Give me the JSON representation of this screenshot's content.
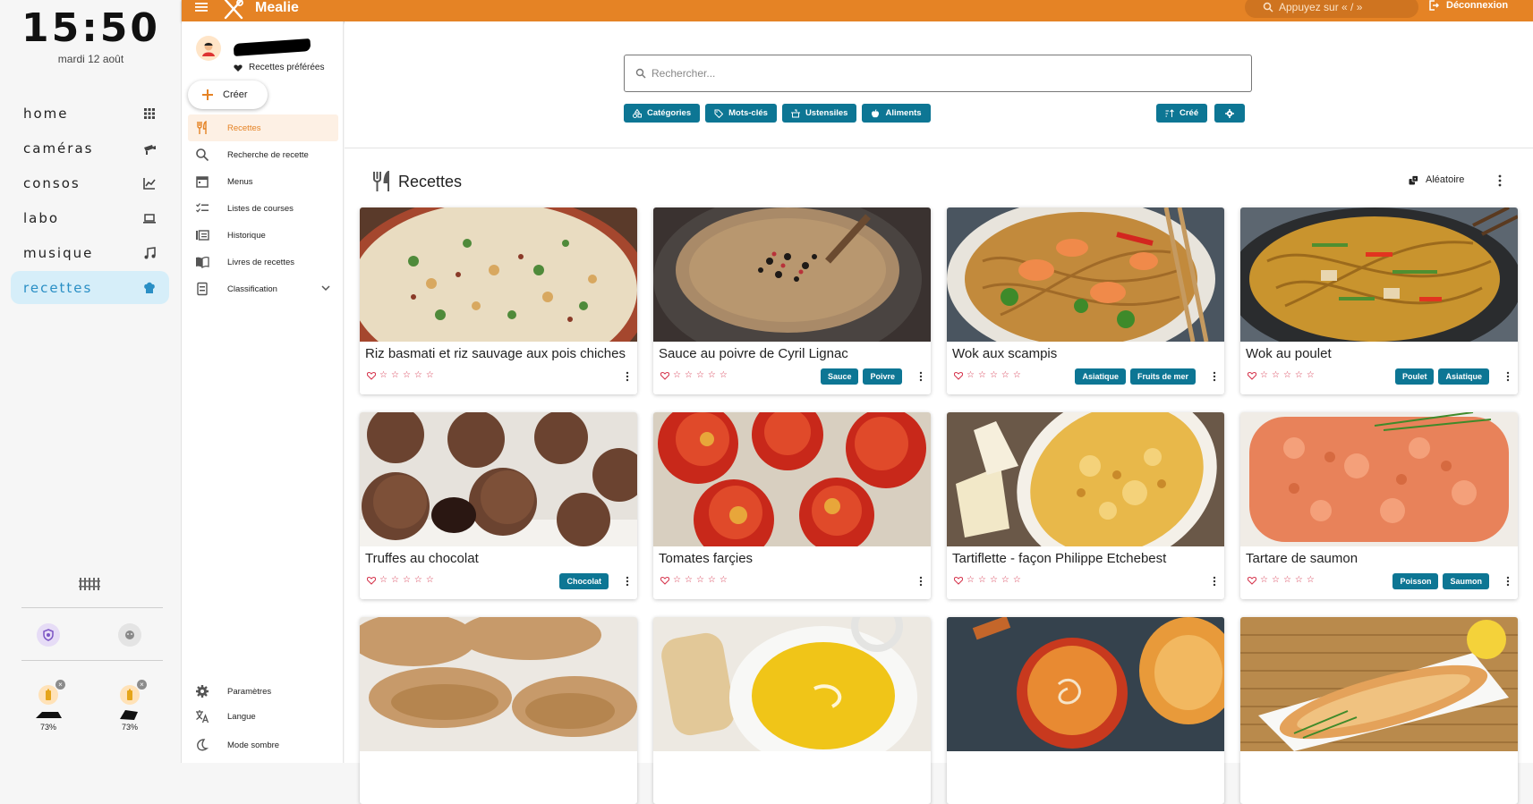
{
  "dashboard": {
    "time": "15:50",
    "date": "mardi 12 août",
    "nav": [
      {
        "label": "home",
        "icon": "grid-icon"
      },
      {
        "label": "caméras",
        "icon": "camera-icon"
      },
      {
        "label": "consos",
        "icon": "chart-icon"
      },
      {
        "label": "labo",
        "icon": "laptop-icon"
      },
      {
        "label": "musique",
        "icon": "music-icon"
      },
      {
        "label": "recettes",
        "icon": "chef-hat-icon",
        "active": true
      }
    ],
    "batteries": [
      {
        "percent": "73%",
        "device": "robot-mower-icon"
      },
      {
        "percent": "73%",
        "device": "robot-mower-icon"
      }
    ]
  },
  "topbar": {
    "title": "Mealie",
    "search_placeholder": "Appuyez sur « / »",
    "logout": "Déconnexion",
    "color": "#e58325"
  },
  "sidebar": {
    "favorites": "Recettes préférées",
    "create": "Créer",
    "items": [
      {
        "label": "Recettes",
        "icon": "utensils-icon",
        "active": true
      },
      {
        "label": "Recherche de recette",
        "icon": "search-icon"
      },
      {
        "label": "Menus",
        "icon": "calendar-icon"
      },
      {
        "label": "Listes de courses",
        "icon": "checklist-icon"
      },
      {
        "label": "Historique",
        "icon": "history-icon"
      },
      {
        "label": "Livres de recettes",
        "icon": "book-icon"
      },
      {
        "label": "Classification",
        "icon": "tag-icon"
      }
    ],
    "bottom": [
      {
        "label": "Paramètres",
        "icon": "gear-icon"
      },
      {
        "label": "Langue",
        "icon": "translate-icon"
      },
      {
        "label": "Mode sombre",
        "icon": "moon-icon"
      }
    ]
  },
  "main": {
    "search_placeholder": "Rechercher...",
    "filters": [
      "Catégories",
      "Mots-clés",
      "Ustensiles",
      "Aliments"
    ],
    "sort_label": "Créé",
    "section_title": "Recettes",
    "random": "Aléatoire",
    "accent": "#0d7694"
  },
  "recipes": [
    {
      "title": "Riz basmati et riz sauvage aux pois chiches",
      "tags": []
    },
    {
      "title": "Sauce au poivre de Cyril Lignac",
      "tags": [
        "Sauce",
        "Poivre"
      ]
    },
    {
      "title": "Wok aux scampis",
      "tags": [
        "Asiatique",
        "Fruits de mer"
      ]
    },
    {
      "title": "Wok au poulet",
      "tags": [
        "Poulet",
        "Asiatique"
      ]
    },
    {
      "title": "Truffes au chocolat",
      "tags": [
        "Chocolat"
      ]
    },
    {
      "title": "Tomates farçies",
      "tags": []
    },
    {
      "title": "Tartiflette - façon Philippe Etchebest",
      "tags": []
    },
    {
      "title": "Tartare de saumon",
      "tags": [
        "Poisson",
        "Saumon"
      ]
    },
    {
      "title": "",
      "tags": []
    },
    {
      "title": "",
      "tags": []
    },
    {
      "title": "",
      "tags": []
    },
    {
      "title": "",
      "tags": []
    }
  ]
}
